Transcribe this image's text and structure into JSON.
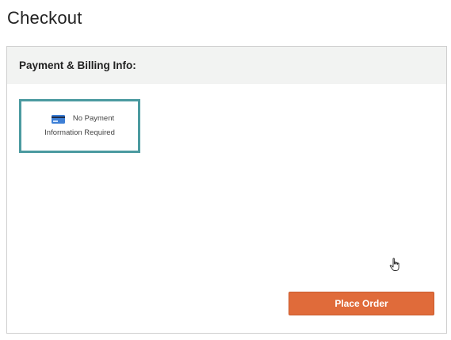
{
  "page": {
    "title": "Checkout"
  },
  "payment_panel": {
    "header_title": "Payment & Billing Info:",
    "card": {
      "icon": "credit-card-icon",
      "line1": "No Payment",
      "line2": "Information Required",
      "border_color": "#4b9aa0"
    }
  },
  "actions": {
    "place_order_label": "Place Order",
    "button_color": "#e06b3a"
  },
  "cursor": {
    "icon": "hand-pointer-icon"
  }
}
